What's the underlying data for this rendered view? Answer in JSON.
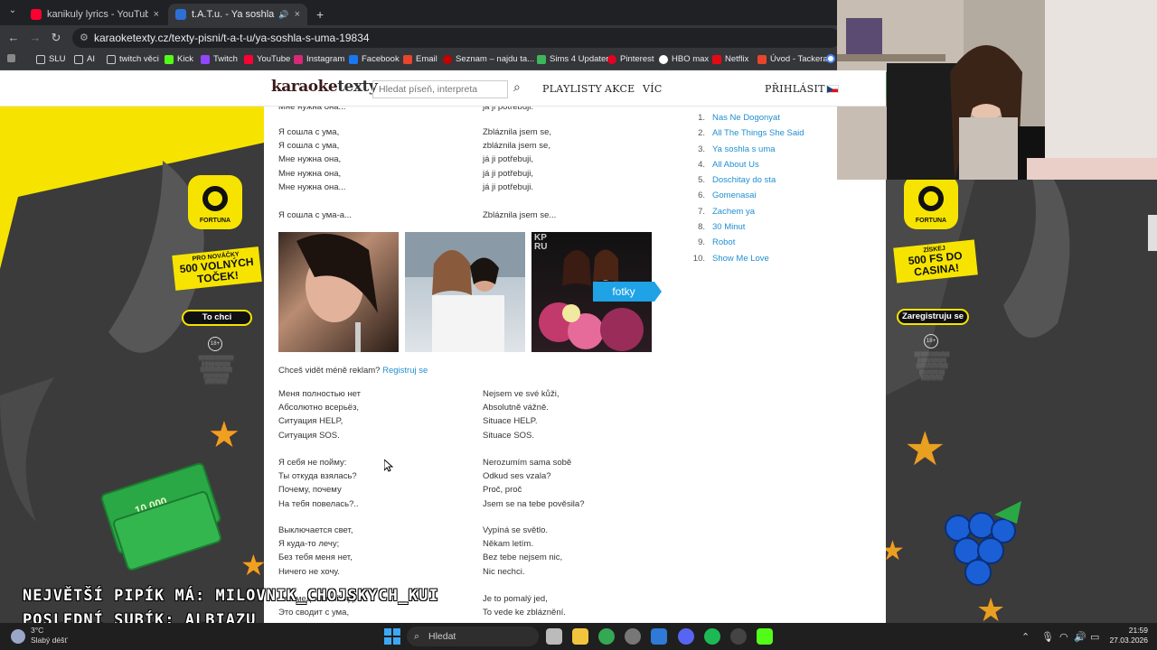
{
  "browser": {
    "tabs": [
      {
        "title": "kanikuly lyrics - YouTube",
        "close": "×"
      },
      {
        "title": "t.A.T.u. - Ya soshla s uma - ",
        "close": "×"
      }
    ],
    "new_tab": "+",
    "url": "karaoketexty.cz/texty-pisni/t-a-t-u/ya-soshla-s-uma-19834",
    "bookmarks": [
      "SLU",
      "AI",
      "twitch věci",
      "Kick",
      "Twitch",
      "YouTube",
      "Instagram",
      "Facebook",
      "Email",
      "Seznam – najdu ta...",
      "Sims 4 Updater",
      "Pinterest",
      "HBO max",
      "Netflix",
      "Úvod - Tackera"
    ]
  },
  "site": {
    "logo_main": "karaoke",
    "logo_rest": "texty",
    "search_placeholder": "Hledat píseň, interpreta",
    "menu": [
      "PLAYLISTY",
      "AKCE",
      "VÍC"
    ],
    "login": "PŘIHLÁSIT"
  },
  "ads": {
    "brand": "FORTUNA",
    "left_promo_top": "PRO NOVÁČKY",
    "left_promo_main": "500 VOLNÝCH TOČEK!",
    "left_button": "To chci",
    "right_promo_top": "ZÍSKEJ",
    "right_promo_main": "500 FS DO CASINA!",
    "right_button": "Zaregistruju se",
    "age_badge": "18+",
    "money_label": "10.000"
  },
  "lyrics": {
    "block0": {
      "ru": "Мне нужна она...",
      "cz": "já ji potřebuji."
    },
    "block1": {
      "ru": "Я сошла с ума,\nЯ сошла с ума,\nМне нужна она,\nМне нужна она,\nМне нужна она...",
      "cz": "Zbláznila jsem se,\nzbláznila jsem se,\njá ji potřebuji,\njá ji potřebuji,\njá ji potřebuji."
    },
    "block2": {
      "ru": "Я сошла с ума-а...",
      "cz": "Zbláznila jsem se..."
    },
    "block3": {
      "ru": "Меня полностью нет\nАбсолютно всерьёз,\nСитуация HELP,\nСитуация SOS.",
      "cz": "Nejsem ve své kůži,\nAbsolutně vážně.\nSituace HELP.\nSituace SOS."
    },
    "block4": {
      "ru": "Я себя не пойму:\nТы откуда взялась?\nПочему, почему\nНа тебя повелась?..",
      "cz": "Nerozumím sama sobě\nOdkud ses vzala?\nProč, proč\nJsem se na tebe pověsila?"
    },
    "block5": {
      "ru": "Выключается свет,\nЯ куда-то лечу;\nБез тебя меня нет,\nНичего не хочу.",
      "cz": "Vypíná se světlo.\nNěkam letím.\nBez tebe nejsem nic,\nNic nechci."
    },
    "block6": {
      "ru": "Это медленный яд,\nЭто сводит с ума,",
      "cz": "Je to pomalý jed,\nTo vede ke zbláznění."
    }
  },
  "photos_label": "fotky",
  "photo_watermark": "KP RU",
  "register_promo": {
    "text": "Chceš vidět méně reklam?",
    "link": "Registruj se"
  },
  "top_songs": [
    {
      "n": "1.",
      "title": "Nas Ne Dogonyat"
    },
    {
      "n": "2.",
      "title": "All The Things She Said"
    },
    {
      "n": "3.",
      "title": "Ya soshla s uma"
    },
    {
      "n": "4.",
      "title": "All About Us"
    },
    {
      "n": "5.",
      "title": "Doschitay do sta"
    },
    {
      "n": "6.",
      "title": "Gomenasai"
    },
    {
      "n": "7.",
      "title": "Zachem ya"
    },
    {
      "n": "8.",
      "title": "30 Minut"
    },
    {
      "n": "9.",
      "title": "Robot"
    },
    {
      "n": "10.",
      "title": "Show Me Love"
    }
  ],
  "stream_overlay": {
    "line1": "NEJVĚTŠÍ PIPÍK MÁ: MILOVNIK_CHOJSKYCH_KUI",
    "line2": "POSLEDNÍ SUBÍK: ALBIAZU"
  },
  "taskbar": {
    "temp": "3°C",
    "weather": "Slabý déšť",
    "search": "Hledat",
    "time": "21:59",
    "date": "27.03.2026"
  },
  "colors": {
    "accent": "#1f8fd0",
    "ad_yellow": "#f6e400",
    "fotky": "#1fa2e6"
  }
}
